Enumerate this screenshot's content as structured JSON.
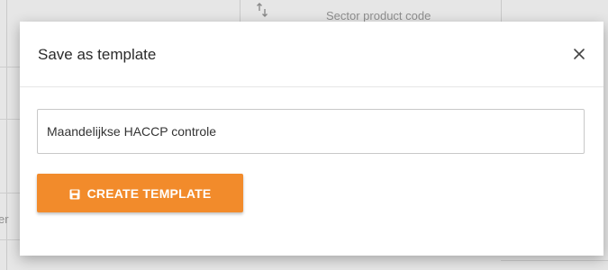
{
  "background": {
    "column_header": "Sector product code",
    "left_fragment": "er"
  },
  "modal": {
    "title": "Save as template",
    "close_icon": "close-icon",
    "template_name_value": "Maandelijkse HACCP controle",
    "create_button_label": "CREATE TEMPLATE",
    "create_button_icon": "save-icon"
  },
  "colors": {
    "accent": "#f28b2b",
    "modal_bg": "#ffffff",
    "backdrop": "#e6e6e6"
  }
}
